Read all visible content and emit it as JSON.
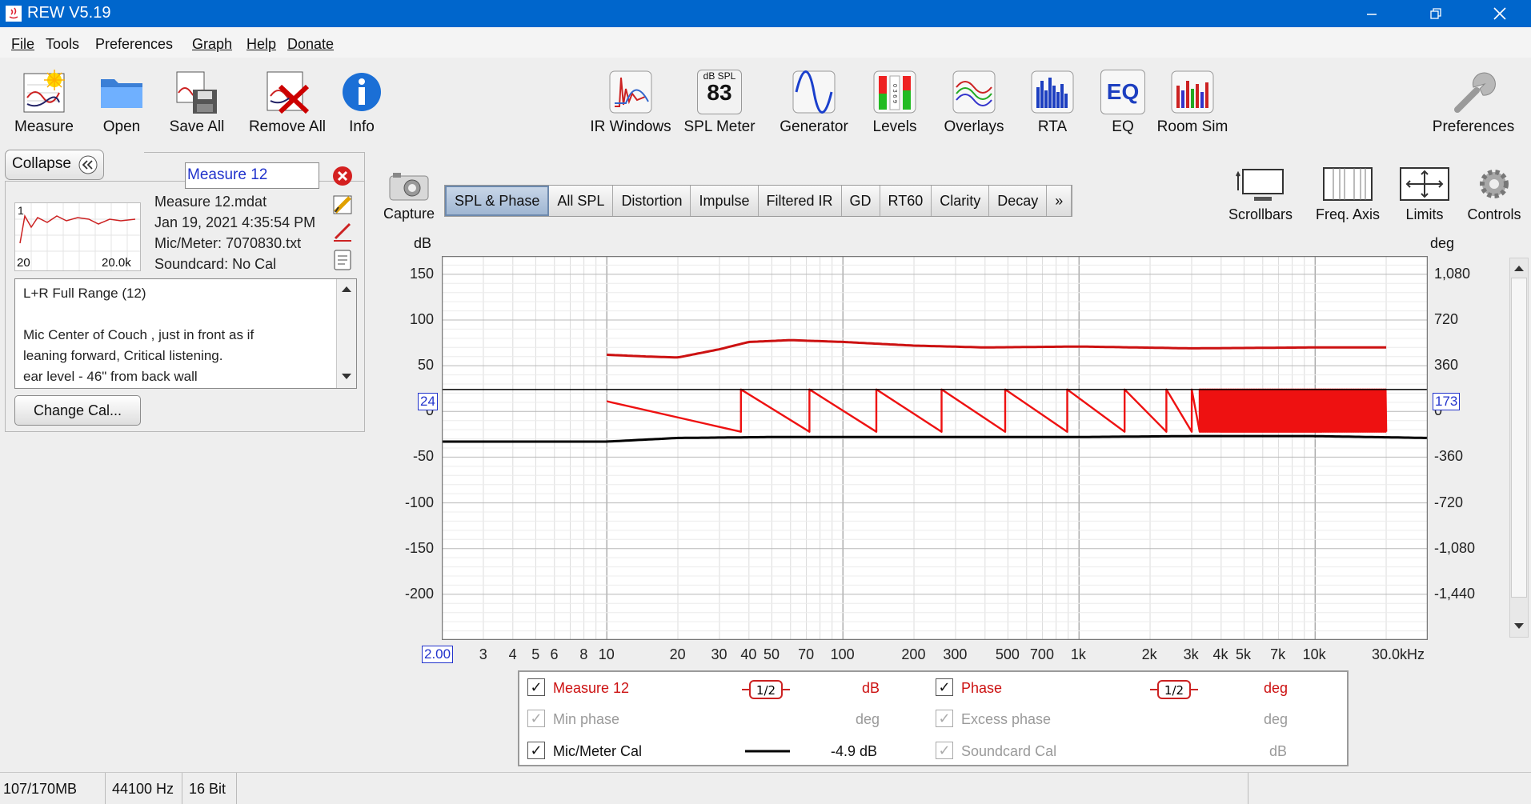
{
  "window": {
    "title": "REW V5.19"
  },
  "menu": [
    {
      "label": "File"
    },
    {
      "label": "Tools"
    },
    {
      "label": "Preferences"
    },
    {
      "label": "Graph"
    },
    {
      "label": "Help"
    },
    {
      "label": "Donate"
    }
  ],
  "toolbar": {
    "measure": "Measure",
    "open": "Open",
    "save_all": "Save All",
    "remove_all": "Remove All",
    "info": "Info",
    "ir_windows": "IR Windows",
    "spl_meter": "SPL Meter",
    "spl_icon_caption": "dB SPL",
    "spl_icon_value": "83",
    "generator": "Generator",
    "levels": "Levels",
    "levels_icon_digits": "0 3 6 9",
    "overlays": "Overlays",
    "rta": "RTA",
    "eq": "EQ",
    "eq_icon_text": "EQ",
    "room_sim": "Room Sim",
    "preferences": "Preferences"
  },
  "panel": {
    "collapse_label": "Collapse",
    "collapse_icon": "double-chevron-left-icon",
    "measurement_name": "Measure 12",
    "file": "Measure 12.mdat",
    "date": "Jan 19, 2021 4:35:54 PM",
    "mic": "Mic/Meter: 7070830.txt",
    "soundcard": "Soundcard: No Cal",
    "thumb_number": "1",
    "thumb_min": "20",
    "thumb_max": "20.0k",
    "notes": [
      "L+R Full Range (12)",
      "",
      "Mic Center of Couch , just in front as if",
      "leaning forward, Critical listening.",
      "ear level - 46\" from back wall"
    ],
    "change_cal": "Change Cal..."
  },
  "capture_label": "Capture",
  "tabs": [
    {
      "label": "SPL & Phase",
      "active": true
    },
    {
      "label": "All SPL"
    },
    {
      "label": "Distortion"
    },
    {
      "label": "Impulse"
    },
    {
      "label": "Filtered IR"
    },
    {
      "label": "GD"
    },
    {
      "label": "RT60"
    },
    {
      "label": "Clarity"
    },
    {
      "label": "Decay"
    },
    {
      "label": "»"
    }
  ],
  "graph_controls": {
    "scrollbars": "Scrollbars",
    "freq_axis": "Freq. Axis",
    "limits": "Limits",
    "controls": "Controls"
  },
  "chart_data": {
    "type": "line",
    "xscale": "log",
    "xlim": [
      2,
      30000
    ],
    "ylim": [
      -250,
      170
    ],
    "ylabel": "dB",
    "y2label": "deg",
    "y2lim": [
      -1800,
      1224
    ],
    "yticks": [
      "150",
      "100",
      "50",
      "0",
      "-50",
      "-100",
      "-150",
      "-200"
    ],
    "y2ticks": [
      "1,080",
      "720",
      "360",
      "0",
      "-360",
      "-720",
      "-1,080",
      "-1,440"
    ],
    "xticks": [
      "3",
      "4",
      "5",
      "6",
      "8",
      "10",
      "20",
      "30",
      "40",
      "50",
      "70",
      "100",
      "200",
      "300",
      "500",
      "700",
      "1k",
      "2k",
      "3k",
      "4k",
      "5k",
      "7k",
      "10k",
      "30.0kHz"
    ],
    "x_min_label": "2.00",
    "cursor_left": "24",
    "cursor_right": "173",
    "cursor_db": 24,
    "grid": true,
    "series": [
      {
        "name": "Measure 12",
        "color": "#cc1111",
        "axis": "dB",
        "x": [
          10,
          15,
          20,
          30,
          40,
          60,
          100,
          200,
          400,
          1000,
          3000,
          10000,
          20000
        ],
        "y": [
          62,
          60,
          59,
          68,
          76,
          78,
          76,
          72,
          70,
          71,
          69,
          70,
          70
        ]
      },
      {
        "name": "Phase",
        "color": "#ee1111",
        "axis": "deg",
        "wrapped": true,
        "x": [
          10,
          30,
          40,
          70,
          150,
          200,
          300,
          500,
          1000,
          2000,
          5000,
          20000
        ],
        "y": [
          80,
          -160,
          173,
          -160,
          60,
          173,
          173,
          173,
          173,
          173,
          173,
          173
        ]
      },
      {
        "name": "Mic/Meter Cal",
        "color": "#000000",
        "axis": "dB",
        "x": [
          2,
          10,
          20,
          50,
          100,
          300,
          1000,
          3000,
          10000,
          30000
        ],
        "y": [
          -33,
          -33,
          -29,
          -28,
          -28,
          -28,
          -28,
          -27,
          -27,
          -29
        ]
      }
    ]
  },
  "legend": [
    {
      "label": "Measure 12",
      "smoothing": "1/2",
      "unit": "dB",
      "checked": true,
      "enabled": true,
      "color": "#cc1111"
    },
    {
      "label": "Phase",
      "smoothing": "1/2",
      "unit": "deg",
      "checked": true,
      "enabled": true,
      "color": "#cc1111"
    },
    {
      "label": "Min phase",
      "unit": "deg",
      "checked": true,
      "enabled": false
    },
    {
      "label": "Excess phase",
      "unit": "deg",
      "checked": true,
      "enabled": false
    },
    {
      "label": "Mic/Meter Cal",
      "unit": "-4.9 dB",
      "checked": true,
      "enabled": true,
      "color": "#000000"
    },
    {
      "label": "Soundcard Cal",
      "unit": "dB",
      "checked": true,
      "enabled": false
    }
  ],
  "status": {
    "memory": "107/170MB",
    "rate": "44100 Hz",
    "bits": "16 Bit"
  }
}
